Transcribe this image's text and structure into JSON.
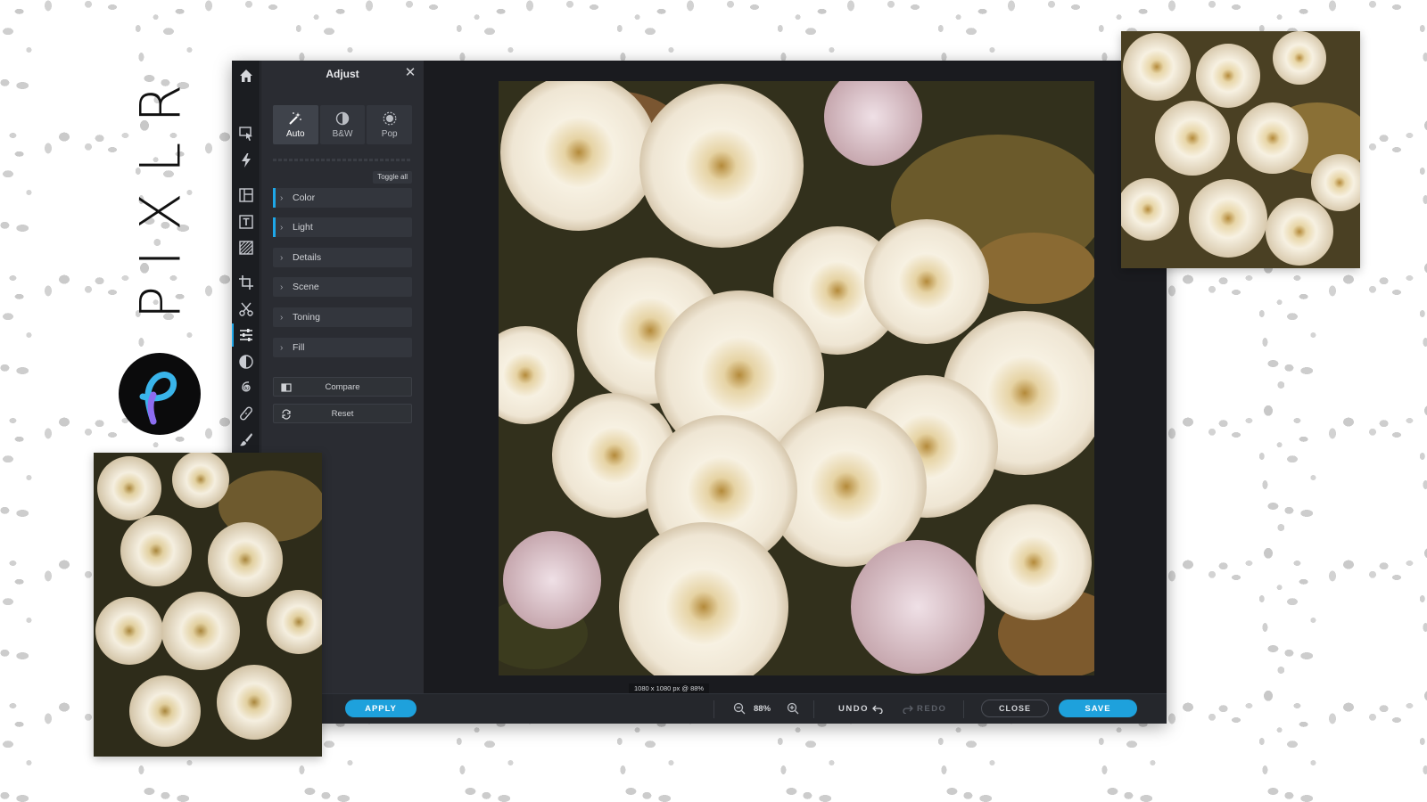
{
  "brand": {
    "wordmark": "PIXLR"
  },
  "panel": {
    "title": "Adjust",
    "presets": [
      {
        "label": "Auto",
        "icon": "magic-wand-icon"
      },
      {
        "label": "B&W",
        "icon": "half-circle-icon"
      },
      {
        "label": "Pop",
        "icon": "sun-icon"
      }
    ],
    "toggle_all": "Toggle all",
    "sections": [
      "Color",
      "Light",
      "Details",
      "Scene",
      "Toning",
      "Fill"
    ],
    "compare": "Compare",
    "reset": "Reset"
  },
  "canvas": {
    "info": "1080 x 1080 px @ 88%"
  },
  "bottombar": {
    "apply": "APPLY",
    "zoom": "88%",
    "undo": "UNDO",
    "redo": "REDO",
    "close": "CLOSE",
    "save": "SAVE"
  },
  "colors": {
    "accent": "#1ea1dc",
    "panel_bg": "#2a2c32",
    "workspace_bg": "#1a1b1f"
  }
}
